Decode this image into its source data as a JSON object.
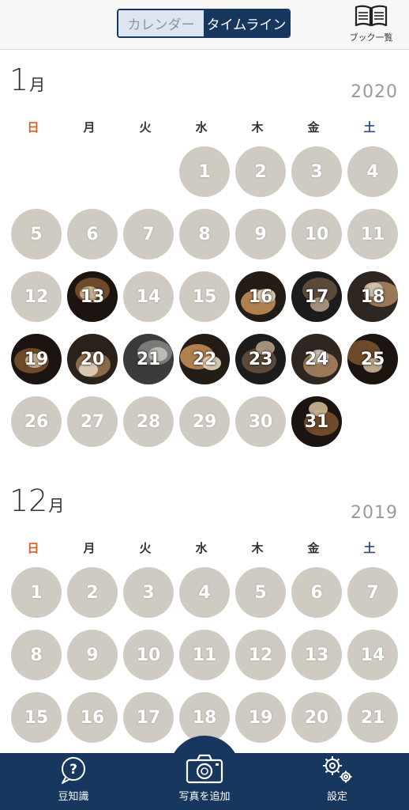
{
  "header": {
    "tabs": [
      {
        "label": "カレンダー",
        "active": false
      },
      {
        "label": "タイムライン",
        "active": true
      }
    ],
    "book_list_label": "ブック一覧",
    "book_icon": "open-book-icon"
  },
  "weekdays": [
    "日",
    "月",
    "火",
    "水",
    "木",
    "金",
    "土"
  ],
  "months": [
    {
      "month_number": "1",
      "month_suffix": "月",
      "year": "2020",
      "days": [
        "1",
        "2",
        "3",
        "4",
        "5",
        "6",
        "7",
        "8",
        "9",
        "10",
        "11",
        "12",
        "13",
        "14",
        "15",
        "16",
        "17",
        "18",
        "19",
        "20",
        "21",
        "22",
        "23",
        "24",
        "25",
        "26",
        "27",
        "28",
        "29",
        "30",
        "31"
      ],
      "photo_days": [
        "13",
        "16",
        "17",
        "18",
        "19",
        "20",
        "21",
        "22",
        "23",
        "24",
        "25",
        "31"
      ]
    },
    {
      "month_number": "12",
      "month_suffix": "月",
      "year": "2019",
      "days": [
        "1",
        "2",
        "3",
        "4",
        "5",
        "6",
        "7",
        "8",
        "9",
        "10",
        "11",
        "12",
        "13",
        "14",
        "15",
        "16",
        "17",
        "18",
        "19",
        "20",
        "21"
      ],
      "photo_days": []
    }
  ],
  "bottom_nav": {
    "tips_label": "豆知識",
    "add_photo_label": "写真を追加",
    "settings_label": "設定",
    "tips_icon": "help-icon",
    "camera_icon": "camera-icon",
    "settings_icon": "gears-icon"
  },
  "colors": {
    "navy": "#17375e",
    "empty_day": "#cfcbc2",
    "sunday": "#e05a1f",
    "saturday": "#2e4a8a"
  }
}
